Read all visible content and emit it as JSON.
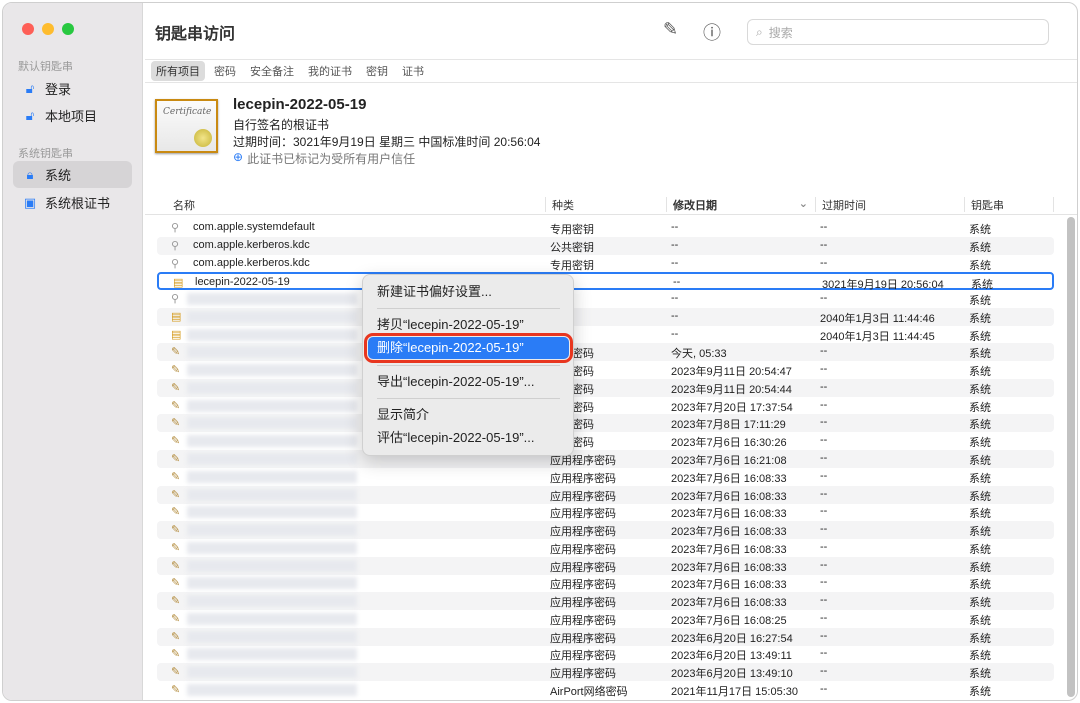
{
  "app": {
    "title": "钥匙串访问",
    "search_placeholder": "搜索",
    "compose_icon": "square-pen-icon",
    "info_icon": "info-icon"
  },
  "sidebar": {
    "default_header": "默认钥匙串",
    "system_header": "系统钥匙串",
    "items": [
      {
        "label": "登录",
        "icon": "unlock-icon"
      },
      {
        "label": "本地项目",
        "icon": "unlock-icon"
      },
      {
        "label": "系统",
        "icon": "lock-icon"
      },
      {
        "label": "系统根证书",
        "icon": "cabinet-icon"
      }
    ]
  },
  "tabs": [
    "所有项目",
    "密码",
    "安全备注",
    "我的证书",
    "密钥",
    "证书"
  ],
  "detail": {
    "name": "lecepin-2022-05-19",
    "kind": "自行签名的根证书",
    "expires": "过期时间：3021年9月19日 星期三 中国标准时间 20:56:04",
    "trust": "此证书已标记为受所有用户信任",
    "cert_text": "Certificate"
  },
  "columns": [
    "名称",
    "种类",
    "修改日期",
    "过期时间",
    "钥匙串"
  ],
  "rows": [
    {
      "icon": "key",
      "name": "com.apple.systemdefault",
      "kind": "专用密钥",
      "modified": "--",
      "expires": "--",
      "keychain": "系统"
    },
    {
      "icon": "key",
      "name": "com.apple.kerberos.kdc",
      "kind": "公共密钥",
      "modified": "--",
      "expires": "--",
      "keychain": "系统"
    },
    {
      "icon": "key",
      "name": "com.apple.kerberos.kdc",
      "kind": "专用密钥",
      "modified": "--",
      "expires": "--",
      "keychain": "系统"
    },
    {
      "icon": "cert",
      "name": "lecepin-2022-05-19",
      "kind": "",
      "modified": "--",
      "expires": "3021年9月19日 20:56:04",
      "keychain": "系统"
    },
    {
      "icon": "key",
      "name": "",
      "kind": "密钥",
      "modified": "--",
      "expires": "--",
      "keychain": "系统"
    },
    {
      "icon": "cert",
      "name": "",
      "kind": "",
      "modified": "--",
      "expires": "2040年1月3日 11:44:46",
      "keychain": "系统"
    },
    {
      "icon": "cert",
      "name": "",
      "kind": "",
      "modified": "--",
      "expires": "2040年1月3日 11:44:45",
      "keychain": "系统"
    },
    {
      "icon": "pen",
      "name": "",
      "kind": "程序密码",
      "modified": "今天, 05:33",
      "expires": "--",
      "keychain": "系统"
    },
    {
      "icon": "pen",
      "name": "",
      "kind": "程序密码",
      "modified": "2023年9月11日 20:54:47",
      "expires": "--",
      "keychain": "系统"
    },
    {
      "icon": "pen",
      "name": "",
      "kind": "程序密码",
      "modified": "2023年9月11日 20:54:44",
      "expires": "--",
      "keychain": "系统"
    },
    {
      "icon": "pen",
      "name": "",
      "kind": "程序密码",
      "modified": "2023年7月20日 17:37:54",
      "expires": "--",
      "keychain": "系统"
    },
    {
      "icon": "pen",
      "name": "",
      "kind": "程序密码",
      "modified": "2023年7月8日 17:11:29",
      "expires": "--",
      "keychain": "系统"
    },
    {
      "icon": "pen",
      "name": "",
      "kind": "程序密码",
      "modified": "2023年7月6日 16:30:26",
      "expires": "--",
      "keychain": "系统"
    },
    {
      "icon": "pen",
      "name": "",
      "kind": "应用程序密码",
      "modified": "2023年7月6日 16:21:08",
      "expires": "--",
      "keychain": "系统"
    },
    {
      "icon": "pen",
      "name": "",
      "kind": "应用程序密码",
      "modified": "2023年7月6日 16:08:33",
      "expires": "--",
      "keychain": "系统"
    },
    {
      "icon": "pen",
      "name": "",
      "kind": "应用程序密码",
      "modified": "2023年7月6日 16:08:33",
      "expires": "--",
      "keychain": "系统"
    },
    {
      "icon": "pen",
      "name": "",
      "kind": "应用程序密码",
      "modified": "2023年7月6日 16:08:33",
      "expires": "--",
      "keychain": "系统"
    },
    {
      "icon": "pen",
      "name": "",
      "kind": "应用程序密码",
      "modified": "2023年7月6日 16:08:33",
      "expires": "--",
      "keychain": "系统"
    },
    {
      "icon": "pen",
      "name": "",
      "kind": "应用程序密码",
      "modified": "2023年7月6日 16:08:33",
      "expires": "--",
      "keychain": "系统"
    },
    {
      "icon": "pen",
      "name": "",
      "kind": "应用程序密码",
      "modified": "2023年7月6日 16:08:33",
      "expires": "--",
      "keychain": "系统"
    },
    {
      "icon": "pen",
      "name": "",
      "kind": "应用程序密码",
      "modified": "2023年7月6日 16:08:33",
      "expires": "--",
      "keychain": "系统"
    },
    {
      "icon": "pen",
      "name": "",
      "kind": "应用程序密码",
      "modified": "2023年7月6日 16:08:33",
      "expires": "--",
      "keychain": "系统"
    },
    {
      "icon": "pen",
      "name": "",
      "kind": "应用程序密码",
      "modified": "2023年7月6日 16:08:25",
      "expires": "--",
      "keychain": "系统"
    },
    {
      "icon": "pen",
      "name": "",
      "kind": "应用程序密码",
      "modified": "2023年6月20日 16:27:54",
      "expires": "--",
      "keychain": "系统"
    },
    {
      "icon": "pen",
      "name": "",
      "kind": "应用程序密码",
      "modified": "2023年6月20日 13:49:11",
      "expires": "--",
      "keychain": "系统"
    },
    {
      "icon": "pen",
      "name": "",
      "kind": "应用程序密码",
      "modified": "2023年6月20日 13:49:10",
      "expires": "--",
      "keychain": "系统"
    },
    {
      "icon": "pen",
      "name": "",
      "kind": "AirPort网络密码",
      "modified": "2021年11月17日 15:05:30",
      "expires": "--",
      "keychain": "系统"
    }
  ],
  "context_menu": [
    "新建证书偏好设置...",
    "拷贝“lecepin-2022-05-19”",
    "删除“lecepin-2022-05-19”",
    "导出“lecepin-2022-05-19”...",
    "显示简介",
    "评估“lecepin-2022-05-19”..."
  ],
  "colors": {
    "accent": "#2a7cf6",
    "highlight_outline": "#e8361f"
  }
}
